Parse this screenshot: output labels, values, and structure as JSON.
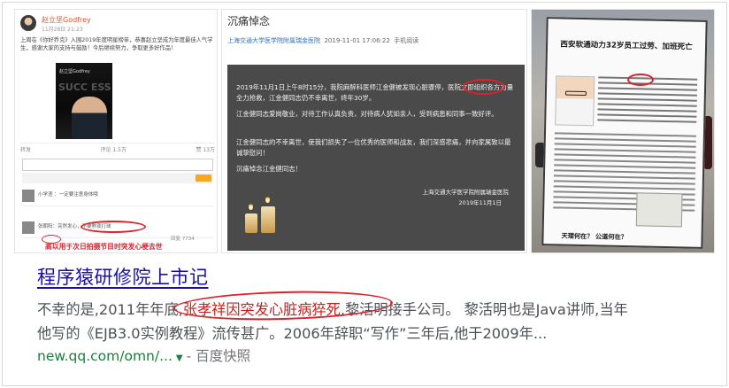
{
  "weibo": {
    "username": "赵立坚Godfrey",
    "time": "11月28日 21:23",
    "text": "上周在《你好乔克》入围2019年度明星榜单，恭喜赵立坚成为年度最佳人气学生，感谢大家的支持与鼓励！今后继续努力，争取更多好作品！",
    "poster_text": "赵立坚Godfrey",
    "poster_big": "SUCC ESS",
    "actions": [
      "转发",
      "评论 1.5万",
      "赞 13万"
    ],
    "comment1": "小学渣 ：一定要注意身体哦",
    "comment2": "张朝阳：突然发心，不要熬夜打球",
    "counts": [
      "回复",
      "7734"
    ],
    "caption": "高以用于次日拍摄节目时突发心梗去世"
  },
  "obituary": {
    "title": "沉痛悼念",
    "meta_source": "上海交通大学医学院附属瑞金医院",
    "meta_time": "2019-11-01 17:06:22",
    "meta_tail": "手机阅读",
    "p1": "2019年11月1日上午8时15分，我院麻醉科医师江金健被发现心脏骤停，医院立即组织各方力量全力抢救，江金健同志仍不幸离世，终年30岁。",
    "p2": "江金健同志爱岗敬业，对待工作认真负责，对待病人犹如亲人，受到病患和同事一致好评。",
    "p3": "江金健同志的不幸离世，使我们损失了一位优秀的医师和战友，我们深感悲痛，并向家属致以最诚挚慰问！",
    "p4": "沉痛悼念江金健同志！",
    "org": "上海交通大学医学院附属瑞金医院",
    "date": "2019年11月1日"
  },
  "sign": {
    "title": "西安软通动力32岁员工过劳、加班死亡",
    "footer": "天理何在？ 公道何在？"
  },
  "result": {
    "title": "程序猿研修院上市记",
    "line1_a": "不幸的是,2011年年底,",
    "line1_red": "张孝祥因突发心脏病猝死",
    "line1_b": ",黎活明接手公司。 黎活明也是Java讲师,当年",
    "line2": "他写的《EJB3.0实例教程》流传甚广。2006年辞职“写作”三年后,他于2009年...",
    "url": "new.qq.com/omn/...",
    "sep": "-",
    "cache": "百度快照"
  },
  "colors": {
    "link": "#1a0dab",
    "highlight": "#d9232d",
    "url": "#188038"
  }
}
